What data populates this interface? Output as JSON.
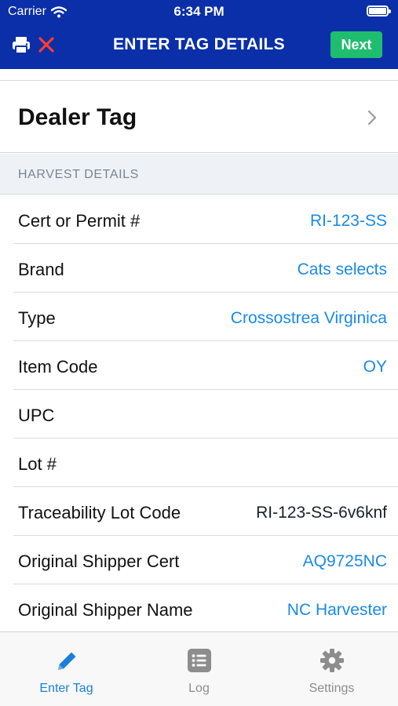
{
  "status_bar": {
    "carrier": "Carrier",
    "time": "6:34 PM"
  },
  "nav": {
    "title": "ENTER TAG DETAILS",
    "next_label": "Next"
  },
  "dealer_tag": {
    "label": "Dealer Tag"
  },
  "section": {
    "title": "HARVEST DETAILS"
  },
  "rows": [
    {
      "label": "Cert or Permit #",
      "value": "RI-123-SS"
    },
    {
      "label": "Brand",
      "value": "Cats selects"
    },
    {
      "label": "Type",
      "value": "Crossostrea Virginica"
    },
    {
      "label": "Item Code",
      "value": "OY"
    },
    {
      "label": "UPC",
      "value": ""
    },
    {
      "label": "Lot #",
      "value": ""
    },
    {
      "label": "Traceability Lot Code",
      "value": "RI-123-SS-6v6knf"
    },
    {
      "label": "Original Shipper Cert",
      "value": "AQ9725NC"
    },
    {
      "label": "Original Shipper Name",
      "value": "NC Harvester"
    }
  ],
  "tabs": [
    {
      "label": "Enter Tag",
      "icon": "pencil-icon",
      "active": true
    },
    {
      "label": "Log",
      "icon": "list-icon",
      "active": false
    },
    {
      "label": "Settings",
      "icon": "gear-icon",
      "active": false
    }
  ],
  "colors": {
    "nav_bg": "#0a2fa8",
    "next_bg": "#1fbe6f",
    "value_blue": "#1a8ae6",
    "section_bg": "#eef2f6",
    "tab_active": "#1a7fdb"
  }
}
